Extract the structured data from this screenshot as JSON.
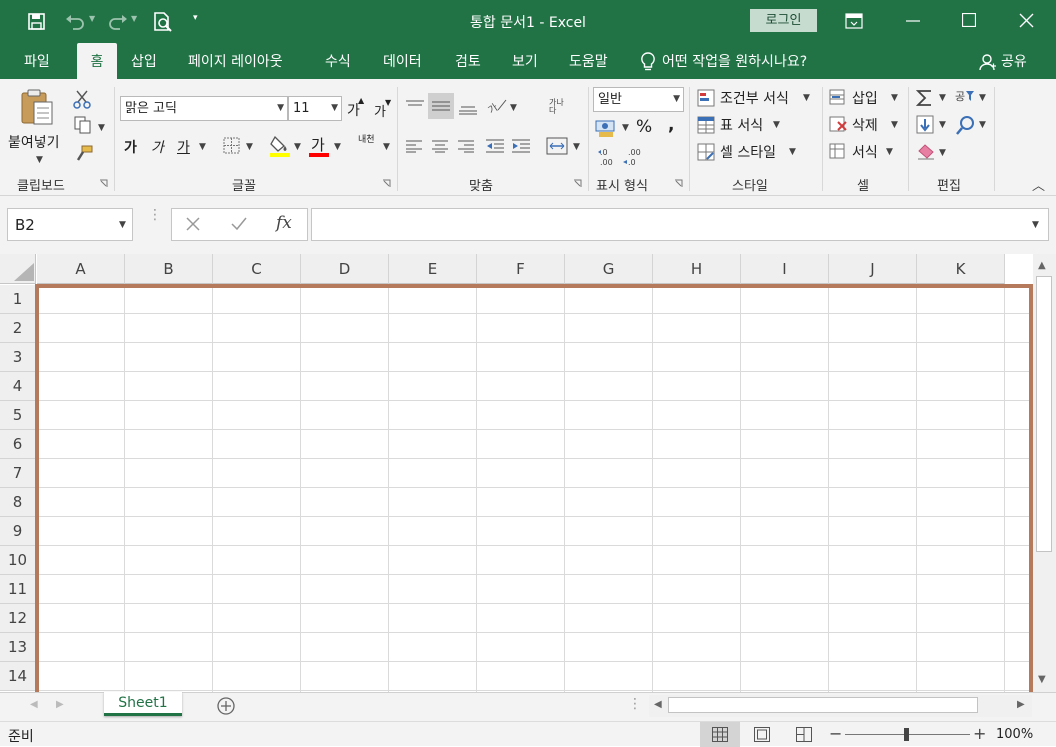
{
  "window": {
    "title": "통합 문서1  -  Excel",
    "login_label": "로그인",
    "accent": "#217346",
    "selection_color": "#b57a5c"
  },
  "tabs": [
    "파일",
    "홈",
    "삽입",
    "페이지 레이아웃",
    "수식",
    "데이터",
    "검토",
    "보기",
    "도움말"
  ],
  "active_tab": "홈",
  "tell_me": "어떤 작업을 원하시나요?",
  "share_label": "공유",
  "ribbon": {
    "clipboard": {
      "paste": "붙여넣기",
      "label": "클립보드"
    },
    "font": {
      "name": "맑은 고딕",
      "size": "11",
      "label": "글꼴",
      "grow": "가",
      "shrink": "가",
      "bold": "가",
      "italic": "가",
      "underline": "가",
      "font_color_glyph": "가",
      "phonetic": "내천"
    },
    "alignment": {
      "label": "맞춤",
      "wrap": "가나다"
    },
    "number": {
      "format": "일반",
      "label": "표시 형식",
      "percent": "%",
      "comma": ","
    },
    "styles": {
      "conditional": "조건부 서식",
      "table": "표 서식",
      "cell": "셀 스타일",
      "label": "스타일"
    },
    "cells": {
      "insert": "삽입",
      "delete": "삭제",
      "format": "서식",
      "label": "셀"
    },
    "editing": {
      "label": "편집",
      "sort": "공"
    }
  },
  "formula_bar": {
    "name_box": "B2",
    "fx": "fx",
    "value": ""
  },
  "columns": [
    "A",
    "B",
    "C",
    "D",
    "E",
    "F",
    "G",
    "H",
    "I",
    "J",
    "K"
  ],
  "rows": [
    "1",
    "2",
    "3",
    "4",
    "5",
    "6",
    "7",
    "8",
    "9",
    "10",
    "11",
    "12",
    "13",
    "14"
  ],
  "sheets": [
    {
      "name": "Sheet1",
      "active": true
    }
  ],
  "status": {
    "ready": "준비",
    "zoom": "100%",
    "zoom_minus": "−",
    "zoom_plus": "+"
  }
}
